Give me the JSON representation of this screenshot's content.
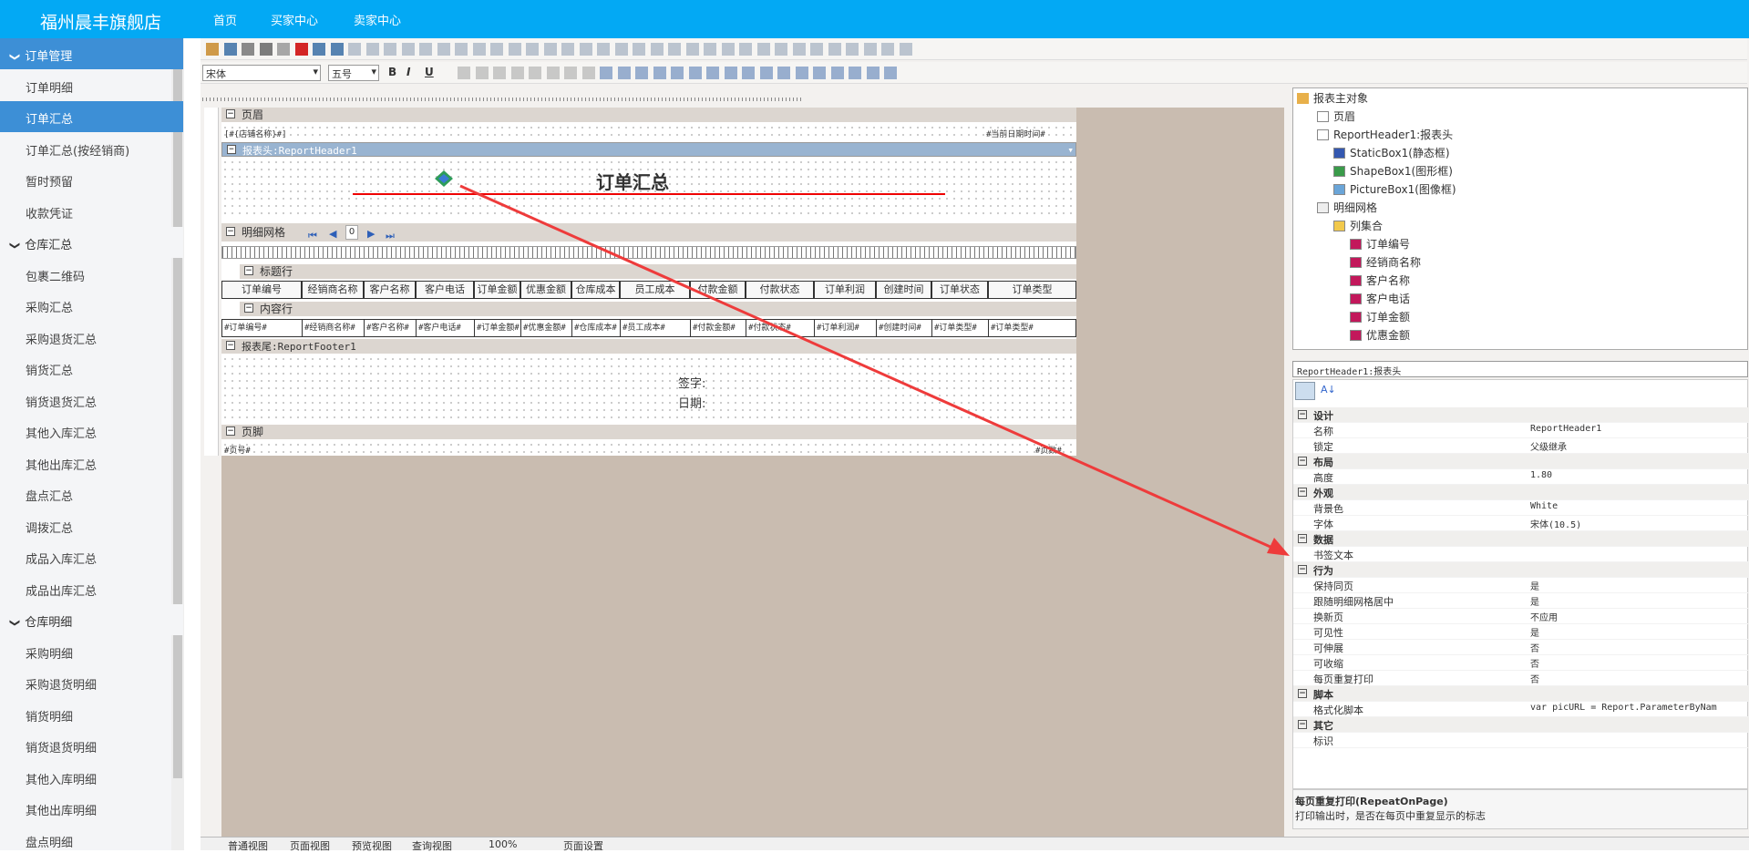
{
  "header": {
    "brand": "福州晨丰旗舰店",
    "nav": [
      "首页",
      "买家中心",
      "卖家中心"
    ]
  },
  "sidebar": {
    "groups": [
      {
        "label": "订单管理",
        "items": [
          "订单明细",
          "订单汇总",
          "订单汇总(按经销商)",
          "暂时预留",
          "收款凭证"
        ]
      },
      {
        "label": "仓库汇总",
        "items": [
          "包裹二维码",
          "采购汇总",
          "采购退货汇总",
          "销货汇总",
          "销货退货汇总",
          "其他入库汇总",
          "其他出库汇总",
          "盘点汇总",
          "调拨汇总",
          "成品入库汇总",
          "成品出库汇总"
        ]
      },
      {
        "label": "仓库明细",
        "items": [
          "采购明细",
          "采购退货明细",
          "销货明细",
          "销货退货明细",
          "其他入库明细",
          "其他出库明细",
          "盘点明细"
        ]
      }
    ]
  },
  "toolbar": {
    "font": "宋体",
    "size": "五号",
    "bold": "B",
    "italic": "I",
    "underline": "U"
  },
  "report": {
    "bands": {
      "page_header": "页眉",
      "report_header": "报表头:ReportHeader1",
      "detail": "明细网格",
      "title_row": "标题行",
      "content_row": "内容行",
      "report_footer": "报表尾:ReportFooter1",
      "page_footer": "页脚"
    },
    "page_header_left": "[#{店铺名称}#]",
    "page_header_right": "#当前日期时间#",
    "title": "订单汇总",
    "nav_page": "0",
    "columns": [
      "订单编号",
      "经销商名称",
      "客户名称",
      "客户电话",
      "订单金额",
      "优惠金额",
      "仓库成本",
      "员工成本",
      "付款金额",
      "付款状态",
      "订单利润",
      "创建时间",
      "订单状态",
      "订单类型"
    ],
    "content": [
      "#订单编号#",
      "#经销商名称#",
      "#客户名称#",
      "#客户电话#",
      "#订单金额#",
      "#优惠金额#",
      "#仓库成本#",
      "#员工成本#",
      "#付款金额#",
      "#付款状态#",
      "#订单利润#",
      "#创建时间#",
      "#订单类型#",
      "#订单类型#"
    ],
    "sign": "签字:",
    "date": "日期:",
    "page_no": "#页号#",
    "page_total": "#页数#"
  },
  "tree": {
    "root": "报表主对象",
    "nodes": [
      "页眉",
      "ReportHeader1:报表头",
      "StaticBox1(静态框)",
      "ShapeBox1(图形框)",
      "PictureBox1(图像框)",
      "明细网格",
      "列集合",
      "订单编号",
      "经销商名称",
      "客户名称",
      "客户电话",
      "订单金额",
      "优惠金额"
    ]
  },
  "props": {
    "object": "ReportHeader1:报表头",
    "rows": [
      {
        "cat": "设计"
      },
      {
        "k": "名称",
        "v": "ReportHeader1"
      },
      {
        "k": "锁定",
        "v": "父级继承"
      },
      {
        "cat": "布局"
      },
      {
        "k": "高度",
        "v": "1.80"
      },
      {
        "cat": "外观"
      },
      {
        "k": "背景色",
        "v": "White"
      },
      {
        "k": "字体",
        "v": "宋体(10.5)"
      },
      {
        "cat": "数据"
      },
      {
        "k": "书签文本",
        "v": ""
      },
      {
        "cat": "行为"
      },
      {
        "k": "保持同页",
        "v": "是"
      },
      {
        "k": "跟随明细网格居中",
        "v": "是"
      },
      {
        "k": "换新页",
        "v": "不应用"
      },
      {
        "k": "可见性",
        "v": "是"
      },
      {
        "k": "可伸展",
        "v": "否"
      },
      {
        "k": "可收缩",
        "v": "否"
      },
      {
        "k": "每页重复打印",
        "v": "否"
      },
      {
        "cat": "脚本"
      },
      {
        "k": "格式化脚本",
        "v": "var picURL = Report.ParameterByNam"
      },
      {
        "cat": "其它"
      },
      {
        "k": "标识",
        "v": ""
      }
    ],
    "desc_title": "每页重复打印(RepeatOnPage)",
    "desc_text": "打印输出时，是否在每页中重复显示的标志"
  },
  "bottom_tabs": [
    "普通视图",
    "页面视图",
    "预览视图",
    "查询视图",
    "100%",
    "页面设置"
  ],
  "colors": {
    "header": "#03a9f4",
    "active": "#3d8fd6",
    "arrow": "#ee3b3b"
  }
}
